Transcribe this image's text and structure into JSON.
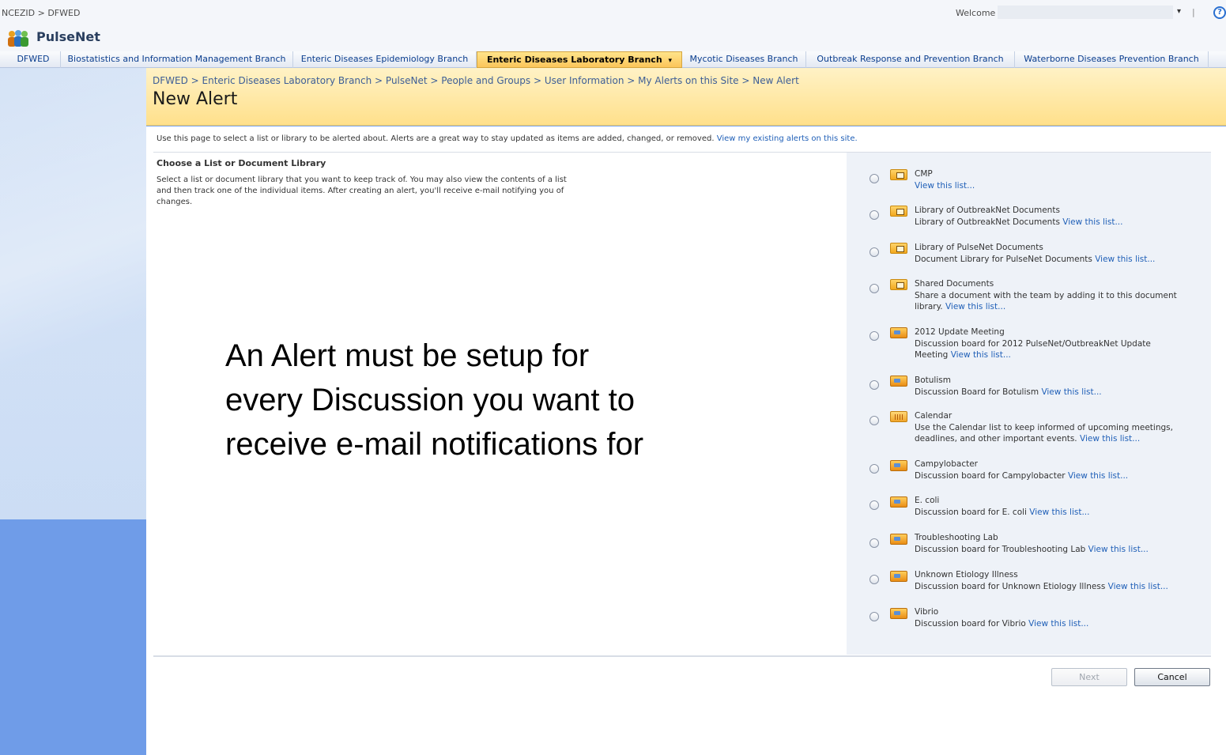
{
  "topbar": {
    "breadcrumb": "NCEZID > DFWED",
    "welcome": "Welcome",
    "user_caret": "▾",
    "separator": "|",
    "help": "?"
  },
  "site": {
    "title": "PulseNet"
  },
  "nav_tabs": [
    "DFWED",
    "Biostatistics and Information Management Branch",
    "Enteric Diseases Epidemiology Branch",
    "Enteric Diseases Laboratory Branch",
    "Mycotic Diseases Branch",
    "Outbreak Response and Prevention Branch",
    "Waterborne Diseases Prevention Branch"
  ],
  "nav_active_caret": "▾",
  "page": {
    "breadcrumb": "DFWED > Enteric Diseases Laboratory Branch > PulseNet > People and Groups > User Information > My Alerts on this Site > New Alert",
    "title": "New Alert",
    "intro": "Use this page to select a list or library to be alerted about. Alerts are a great way to stay updated as items are added, changed, or removed.",
    "intro_link": "View my existing alerts on this site."
  },
  "section": {
    "title": "Choose a List or Document Library",
    "desc_lines": [
      "Select a list or document library that you want to keep track of. You may also view the contents of a list",
      "and then track one of the individual items. After creating an alert, you'll receive e-mail notifying you of",
      "changes."
    ]
  },
  "lists": [
    {
      "name": "CMP",
      "desc": [],
      "link": "View this list...",
      "icon": "document-library-icon"
    },
    {
      "name": "Library of OutbreakNet Documents",
      "desc": [
        "Library of OutbreakNet Documents"
      ],
      "link": "View this list...",
      "icon": "document-library-icon"
    },
    {
      "name": "Library of PulseNet Documents",
      "desc": [
        "Document Library for PulseNet Documents"
      ],
      "link": "View this list...",
      "icon": "document-library-icon"
    },
    {
      "name": "Shared Documents",
      "desc": [
        "Share a document with the team by adding it to this document",
        "library."
      ],
      "link": "View this list...",
      "icon": "document-library-icon"
    },
    {
      "name": "2012 Update Meeting",
      "desc": [
        "Discussion board for 2012 PulseNet/OutbreakNet Update",
        "Meeting"
      ],
      "link": "View this list...",
      "icon": "discussion-board-icon"
    },
    {
      "name": "Botulism",
      "desc": [
        "Discussion Board for Botulism"
      ],
      "link": "View this list...",
      "icon": "discussion-board-icon"
    },
    {
      "name": "Calendar",
      "desc": [
        "Use the Calendar list to keep informed of upcoming meetings,",
        "deadlines, and other important events."
      ],
      "link": "View this list...",
      "icon": "calendar-icon"
    },
    {
      "name": "Campylobacter",
      "desc": [
        "Discussion board for Campylobacter"
      ],
      "link": "View this list...",
      "icon": "discussion-board-icon"
    },
    {
      "name": "E. coli",
      "desc": [
        "Discussion board for E. coli"
      ],
      "link": "View this list...",
      "icon": "discussion-board-icon"
    },
    {
      "name": "Troubleshooting Lab",
      "desc": [
        "Discussion board for Troubleshooting Lab"
      ],
      "link": "View this list...",
      "icon": "discussion-board-icon"
    },
    {
      "name": "Unknown Etiology Illness",
      "desc": [
        "Discussion board for Unknown Etiology Illness"
      ],
      "link": "View this list...",
      "icon": "discussion-board-icon"
    },
    {
      "name": "Vibrio",
      "desc": [
        "Discussion board for Vibrio"
      ],
      "link": "View this list...",
      "icon": "discussion-board-icon"
    }
  ],
  "buttons": {
    "next": "Next",
    "cancel": "Cancel"
  },
  "callout": {
    "lines": [
      "An Alert must be setup for",
      "every Discussion you want to",
      "receive e-mail notifications for"
    ]
  }
}
